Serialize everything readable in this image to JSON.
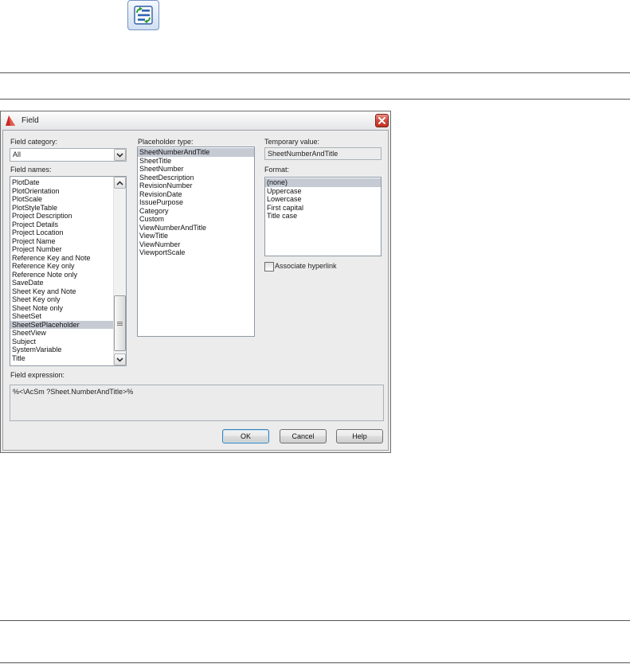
{
  "toolbar": {
    "update_fields_icon": "update-fields-icon"
  },
  "dialog": {
    "title": "Field",
    "icons": {
      "app": "autocad-app-icon",
      "close": "close-icon",
      "dropdown": "chevron-down-icon",
      "scroll_up": "chevron-up-icon",
      "scroll_down": "chevron-down-icon"
    },
    "field_category": {
      "label": "Field category:",
      "value": "All"
    },
    "field_names": {
      "label": "Field names:",
      "items": [
        {
          "label": "PlotDate"
        },
        {
          "label": "PlotOrientation"
        },
        {
          "label": "PlotScale"
        },
        {
          "label": "PlotStyleTable"
        },
        {
          "label": "Project Description"
        },
        {
          "label": "Project Details"
        },
        {
          "label": "Project Location"
        },
        {
          "label": "Project Name"
        },
        {
          "label": "Project Number"
        },
        {
          "label": "Reference Key and Note"
        },
        {
          "label": "Reference Key only"
        },
        {
          "label": "Reference Note only"
        },
        {
          "label": "SaveDate"
        },
        {
          "label": "Sheet Key and Note"
        },
        {
          "label": "Sheet Key only"
        },
        {
          "label": "Sheet Note only"
        },
        {
          "label": "SheetSet"
        },
        {
          "label": "SheetSetPlaceholder",
          "selected": true
        },
        {
          "label": "SheetView"
        },
        {
          "label": "Subject"
        },
        {
          "label": "SystemVariable"
        },
        {
          "label": "Title"
        }
      ]
    },
    "placeholder_type": {
      "label": "Placeholder type:",
      "items": [
        {
          "label": "SheetNumberAndTitle",
          "selected": true
        },
        {
          "label": "SheetTitle"
        },
        {
          "label": "SheetNumber"
        },
        {
          "label": "SheetDescription"
        },
        {
          "label": "RevisionNumber"
        },
        {
          "label": "RevisionDate"
        },
        {
          "label": "IssuePurpose"
        },
        {
          "label": "Category"
        },
        {
          "label": "Custom"
        },
        {
          "label": "ViewNumberAndTitle"
        },
        {
          "label": "ViewTitle"
        },
        {
          "label": "ViewNumber"
        },
        {
          "label": "ViewportScale"
        }
      ]
    },
    "temporary_value": {
      "label": "Temporary value:",
      "value": "SheetNumberAndTitle"
    },
    "format": {
      "label": "Format:",
      "items": [
        {
          "label": "(none)",
          "selected": true
        },
        {
          "label": "Uppercase"
        },
        {
          "label": "Lowercase"
        },
        {
          "label": "First capital"
        },
        {
          "label": "Title case"
        }
      ]
    },
    "associate_hyperlink": {
      "label": "Associate hyperlink",
      "checked": false
    },
    "field_expression": {
      "label": "Field expression:",
      "value": "%<\\AcSm ?Sheet.NumberAndTitle>%"
    },
    "buttons": {
      "ok": "OK",
      "cancel": "Cancel",
      "help": "Help"
    }
  }
}
